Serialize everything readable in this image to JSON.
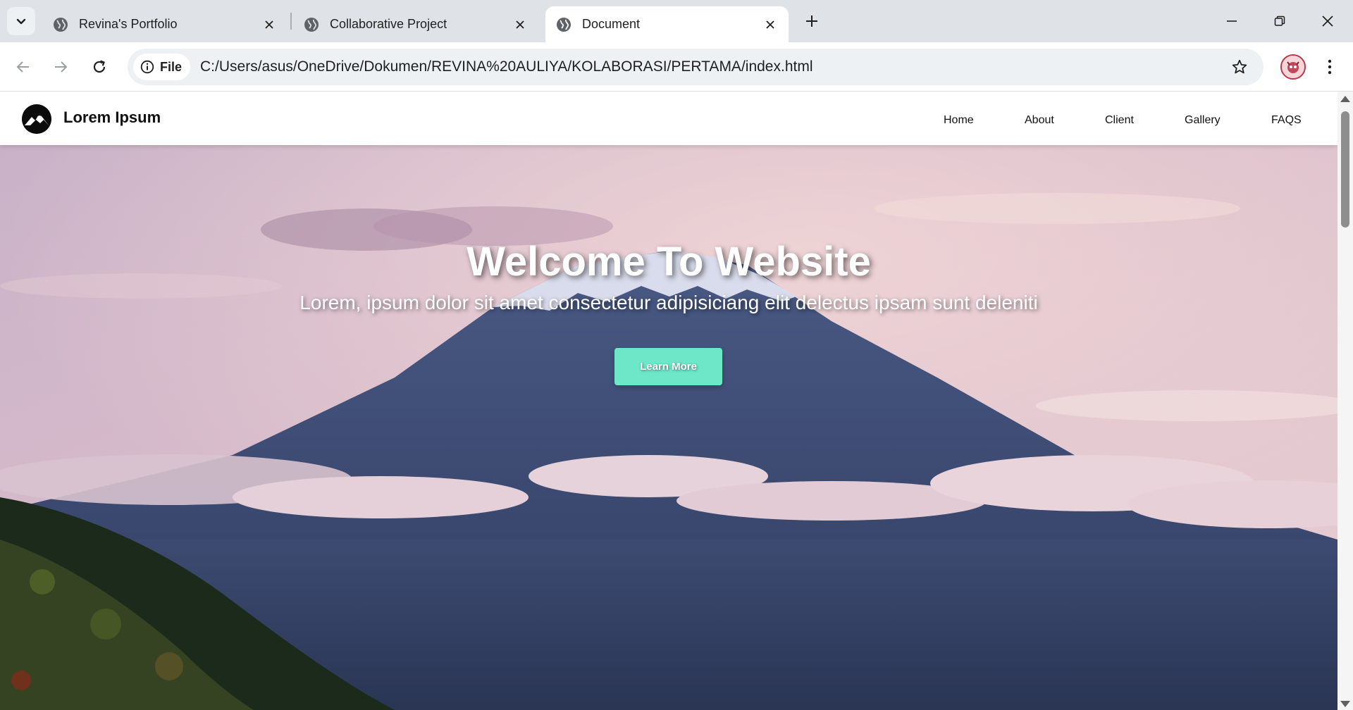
{
  "browser": {
    "tabs": [
      {
        "title": "Revina's Portfolio",
        "icon": "globe-icon",
        "active": false
      },
      {
        "title": "Collaborative Project",
        "icon": "globe-icon",
        "active": false
      },
      {
        "title": "Document",
        "icon": "globe-icon",
        "active": true
      }
    ],
    "omnibox": {
      "site_chip": "File",
      "url": "C:/Users/asus/OneDrive/Dokumen/REVINA%20AULIYA/KOLABORASI/PERTAMA/index.html"
    }
  },
  "site": {
    "brand": "Lorem Ipsum",
    "nav": [
      "Home",
      "About",
      "Client",
      "Gallery",
      "FAQS"
    ],
    "hero": {
      "title": "Welcome To Website",
      "subtitle": "Lorem, ipsum dolor sit amet consectetur adipisiciang elit delectus ipsam sunt deleniti",
      "cta_label": "Learn More"
    }
  },
  "colors": {
    "cta_bg": "#6ee7c8",
    "nav_bg": "#ffffff",
    "tabstrip_bg": "#dfe3e8"
  }
}
